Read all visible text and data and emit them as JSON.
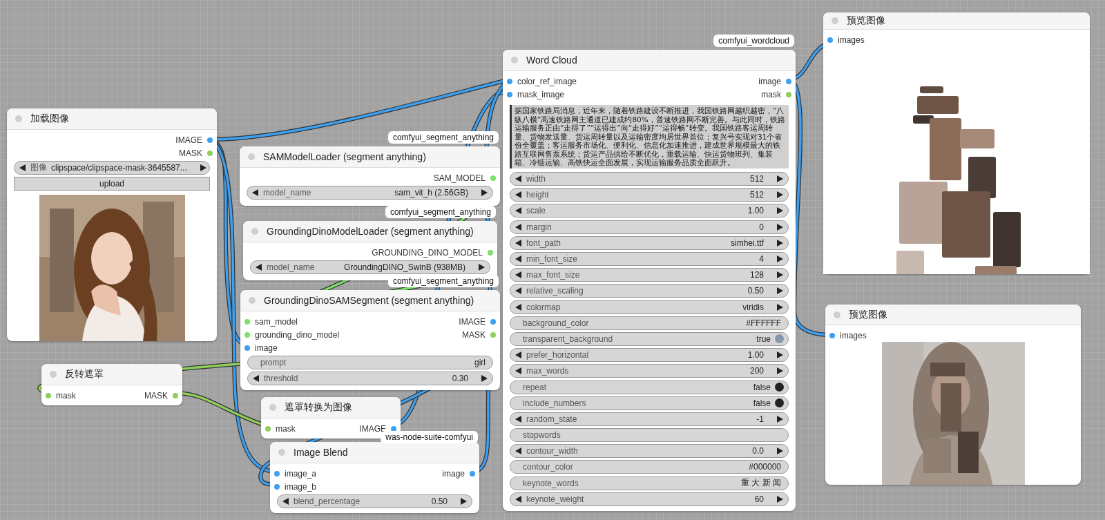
{
  "nodes": [
    {
      "title": "加载图像",
      "outputs": [
        {
          "label": "IMAGE",
          "color": "#3ea0f0"
        },
        {
          "label": "MASK",
          "color": "#8fcf5a"
        }
      ],
      "widgets": [
        {
          "kind": "combo",
          "label": "图像",
          "value": "clipspace/clipspace-mask-3645587..."
        },
        {
          "kind": "button",
          "label": "upload"
        }
      ],
      "preview": {
        "kind": "picture"
      }
    },
    {
      "title": "SAMModelLoader (segment anything)",
      "badge": "comfyui_segment_anything",
      "outputs": [
        {
          "label": "SAM_MODEL",
          "color": "#7de06a"
        }
      ],
      "widgets": [
        {
          "kind": "combo",
          "label": "model_name",
          "value": "sam_vit_h (2.56GB)"
        }
      ]
    },
    {
      "title": "GroundingDinoModelLoader (segment anything)",
      "badge": "comfyui_segment_anything",
      "outputs": [
        {
          "label": "GROUNDING_DINO_MODEL",
          "color": "#7de06a"
        }
      ],
      "widgets": [
        {
          "kind": "combo",
          "label": "model_name",
          "value": "GroundingDINO_SwinB (938MB)"
        }
      ]
    },
    {
      "title": "GroundingDinoSAMSegment (segment anything)",
      "badge": "comfyui_segment_anything",
      "inputs": [
        {
          "label": "sam_model",
          "color": "#7de06a"
        },
        {
          "label": "grounding_dino_model",
          "color": "#7de06a"
        },
        {
          "label": "image",
          "color": "#3ea0f0"
        }
      ],
      "outputs": [
        {
          "label": "IMAGE",
          "color": "#3ea0f0"
        },
        {
          "label": "MASK",
          "color": "#8fcf5a"
        }
      ],
      "widgets": [
        {
          "kind": "text",
          "label": "prompt",
          "value": "girl"
        },
        {
          "kind": "number",
          "label": "threshold",
          "value": "0.30"
        }
      ]
    },
    {
      "title": "反转遮罩",
      "inputs": [
        {
          "label": "mask",
          "color": "#8fcf5a"
        }
      ],
      "outputs": [
        {
          "label": "MASK",
          "color": "#8fcf5a"
        }
      ]
    },
    {
      "title": "遮罩转换为图像",
      "inputs": [
        {
          "label": "mask",
          "color": "#8fcf5a"
        }
      ],
      "outputs": [
        {
          "label": "IMAGE",
          "color": "#3ea0f0"
        }
      ]
    },
    {
      "title": "Image Blend",
      "badge": "was-node-suite-comfyui",
      "inputs": [
        {
          "label": "image_a",
          "color": "#3ea0f0"
        },
        {
          "label": "image_b",
          "color": "#3ea0f0"
        }
      ],
      "outputs": [
        {
          "label": "image",
          "color": "#3ea0f0"
        }
      ],
      "widgets": [
        {
          "kind": "number",
          "label": "blend_percentage",
          "value": "0.50"
        }
      ]
    },
    {
      "title": "Word Cloud",
      "badge": "comfyui_wordcloud",
      "inputs": [
        {
          "label": "color_ref_image",
          "color": "#3ea0f0"
        },
        {
          "label": "mask_image",
          "color": "#3ea0f0"
        }
      ],
      "outputs": [
        {
          "label": "image",
          "color": "#3ea0f0"
        },
        {
          "label": "mask",
          "color": "#8fcf5a"
        }
      ],
      "text_area": "据国家铁路局消息，近年来，随着铁路建设不断推进，我国铁路网越织越密，“八纵八横”高速铁路网主通道已建成约80%，普速铁路网不断完善。与此同时，铁路运输服务正由“走得了”“运得出”向“走得好”“运得畅”转变。我国铁路客运周转量、货物发送量、货运周转量以及运输密度均居世界首位；复兴号实现对31个省份全覆盖；客运服务市场化、便利化、信息化加速推进，建成世界规模最大的铁路互联网售票系统；货运产品供给不断优化，重载运输、快运货物班列、集装箱、冷链运输、高铁快运全面发展，实现运输服务品质全面跃升。",
      "widgets": [
        {
          "kind": "number",
          "label": "width",
          "value": "512"
        },
        {
          "kind": "number",
          "label": "height",
          "value": "512"
        },
        {
          "kind": "number",
          "label": "scale",
          "value": "1.00"
        },
        {
          "kind": "number",
          "label": "margin",
          "value": "0"
        },
        {
          "kind": "combo",
          "label": "font_path",
          "value": "simhei.ttf"
        },
        {
          "kind": "number",
          "label": "min_font_size",
          "value": "4"
        },
        {
          "kind": "number",
          "label": "max_font_size",
          "value": "128"
        },
        {
          "kind": "number",
          "label": "relative_scaling",
          "value": "0.50"
        },
        {
          "kind": "combo",
          "label": "colormap",
          "value": "viridis"
        },
        {
          "kind": "text",
          "label": "background_color",
          "value": "#FFFFFF"
        },
        {
          "kind": "toggle",
          "label": "transparent_background",
          "value": "true",
          "on": true
        },
        {
          "kind": "number",
          "label": "prefer_horizontal",
          "value": "1.00"
        },
        {
          "kind": "number",
          "label": "max_words",
          "value": "200"
        },
        {
          "kind": "toggle",
          "label": "repeat",
          "value": "false",
          "on": false
        },
        {
          "kind": "toggle",
          "label": "include_numbers",
          "value": "false",
          "on": false
        },
        {
          "kind": "number",
          "label": "random_state",
          "value": "-1"
        },
        {
          "kind": "text",
          "label": "stopwords"
        },
        {
          "kind": "number",
          "label": "contour_width",
          "value": "0.0"
        },
        {
          "kind": "text",
          "label": "contour_color",
          "value": "#000000"
        },
        {
          "kind": "text",
          "label": "keynote_words",
          "value": "重 大 新 闻"
        },
        {
          "kind": "number",
          "label": "keynote_weight",
          "value": "60"
        }
      ]
    },
    {
      "title": "预览图像",
      "inputs": [
        {
          "label": "images",
          "color": "#3ea0f0"
        }
      ],
      "preview": {
        "kind": "picture"
      }
    },
    {
      "title": "预览图像",
      "inputs": [
        {
          "label": "images",
          "color": "#3ea0f0"
        }
      ],
      "preview": {
        "kind": "picture"
      }
    }
  ]
}
